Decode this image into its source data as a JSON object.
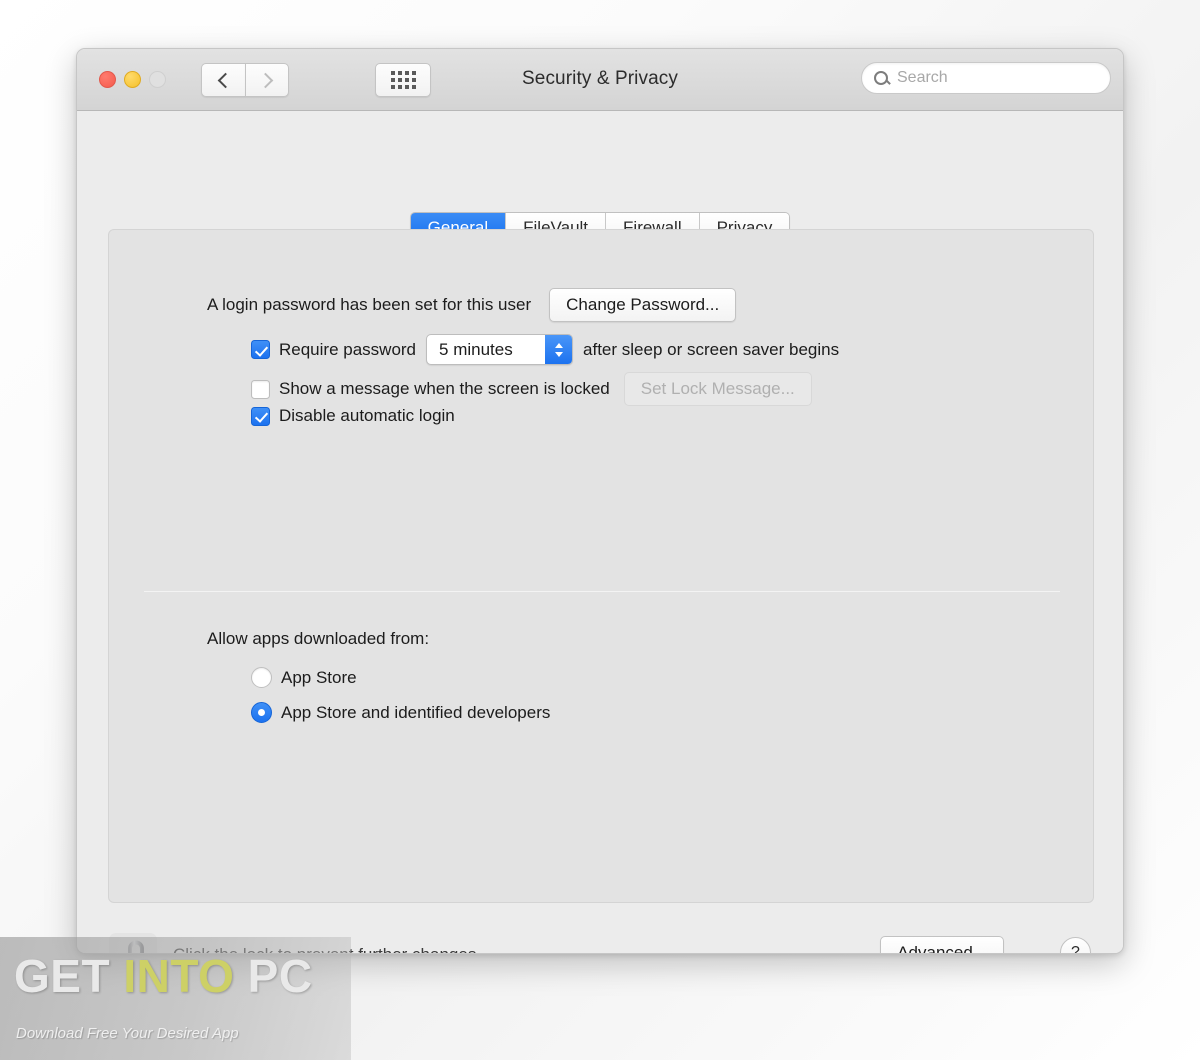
{
  "window": {
    "title": "Security & Privacy",
    "traffic_lights": [
      {
        "name": "close",
        "color": "#f45b4d"
      },
      {
        "name": "minimize",
        "color": "#f5c02b"
      },
      {
        "name": "zoom",
        "color": "#e0e0e0"
      }
    ],
    "nav": {
      "back_label": "Back",
      "forward_label": "Forward",
      "grid_label": "Show All"
    },
    "search": {
      "value": "",
      "placeholder": "Search"
    }
  },
  "tabs": [
    {
      "label": "General",
      "active": true
    },
    {
      "label": "FileVault",
      "active": false
    },
    {
      "label": "Firewall",
      "active": false
    },
    {
      "label": "Privacy",
      "active": false
    }
  ],
  "general": {
    "login_password_text": "A login password has been set for this user",
    "change_password_button": "Change Password...",
    "require_password": {
      "checked": true,
      "label_before": "Require password",
      "delay_value": "5 minutes",
      "label_after": "after sleep or screen saver begins"
    },
    "show_message": {
      "checked": false,
      "label": "Show a message when the screen is locked",
      "button": "Set Lock Message...",
      "button_disabled": true
    },
    "disable_auto_login": {
      "checked": true,
      "label": "Disable automatic login"
    },
    "allow_apps": {
      "heading": "Allow apps downloaded from:",
      "options": [
        {
          "label": "App Store",
          "selected": false
        },
        {
          "label": "App Store and identified developers",
          "selected": true
        }
      ]
    }
  },
  "footer": {
    "lock_state": "unlocked",
    "lock_text": "Click the lock to prevent further changes.",
    "advanced_button": "Advanced...",
    "help_button": "?"
  },
  "watermark": {
    "title_part1": "GET ",
    "title_highlight": "INTO",
    "title_part2": " PC",
    "subtitle": "Download Free Your Desired App",
    "highlight_color": "#cdd066"
  }
}
